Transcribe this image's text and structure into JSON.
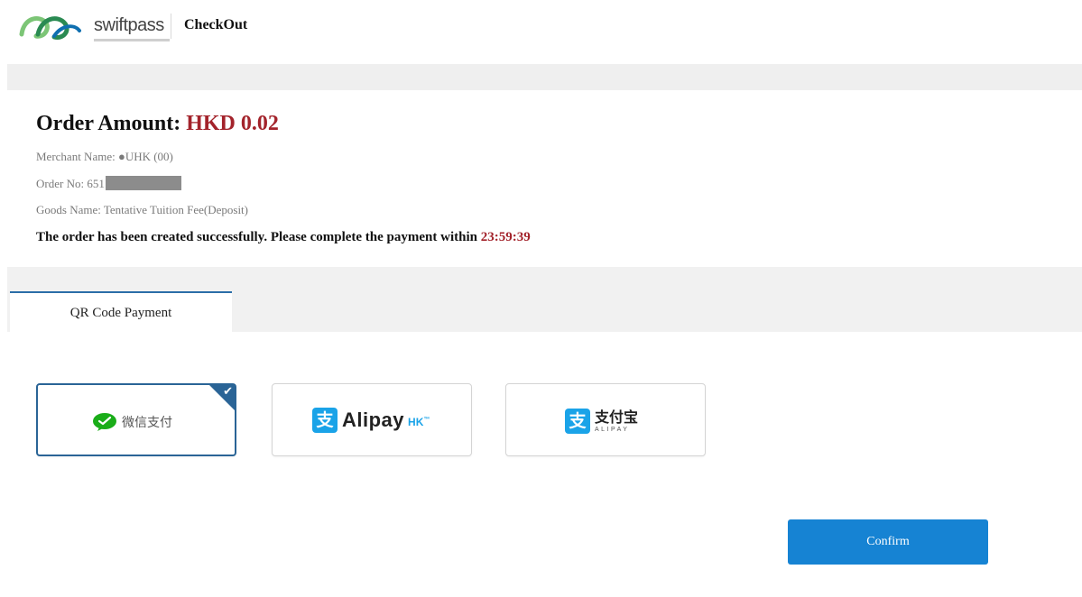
{
  "header": {
    "logo_text": "swiftpass",
    "title": "CheckOut"
  },
  "order": {
    "amount_label": "Order Amount:",
    "amount_value": "HKD 0.02",
    "merchant_text": "Merchant Name: ●UHK (00)",
    "order_no_prefix": "Order No: 651",
    "goods_text": "Goods Name: Tentative Tuition Fee(Deposit)",
    "notice_text": "The order has been created successfully. Please complete the payment within",
    "countdown": "23:59:39"
  },
  "tabs": [
    {
      "label": "QR Code Payment",
      "active": true
    }
  ],
  "payment_options": {
    "wechat": {
      "label": "微信支付",
      "icon": "wechat-pay-icon",
      "selected": true
    },
    "alipay_hk": {
      "glyph": "支",
      "text": "Alipay",
      "suffix": "HK",
      "tm": "™",
      "icon": "alipay-icon",
      "selected": false
    },
    "alipay": {
      "glyph": "支",
      "cn": "支付宝",
      "en": "ALIPAY",
      "icon": "alipay-icon",
      "selected": false
    },
    "check_glyph": "✔"
  },
  "actions": {
    "confirm_label": "Confirm"
  },
  "colors": {
    "accent_blue": "#1683d3",
    "selected_border": "#2a6496",
    "amount_red": "#a3232b",
    "wechat_green": "#1aad19",
    "alipay_blue": "#1aa3e8"
  }
}
